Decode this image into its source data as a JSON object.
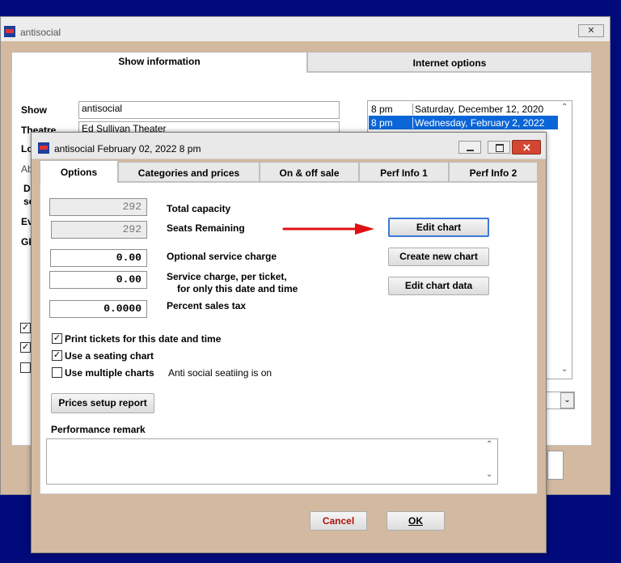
{
  "back_window": {
    "title": "antisocial",
    "close_glyph": "✕",
    "tabs": [
      "Show information",
      "Internet options"
    ],
    "labels": {
      "show": "Show",
      "theatre": "Theatre",
      "location_partial": "Lo",
      "ab_partial": "Ab",
      "di_partial": "Di",
      "se_partial": "se",
      "ev_partial": "Ev",
      "gl_partial": "GL"
    },
    "show_value": "antisocial",
    "theatre_value": "Ed Sullivan Theater",
    "performances": [
      {
        "time": "8 pm",
        "date": "Saturday, December 12, 2020",
        "selected": false
      },
      {
        "time": "8 pm",
        "date": "Wednesday, February 2, 2022",
        "selected": true
      }
    ]
  },
  "dialog": {
    "title": "antisocial February 02, 2022 8 pm",
    "tabs": [
      "Options",
      "Categories and prices",
      "On & off sale",
      "Perf Info 1",
      "Perf Info 2"
    ],
    "total_capacity": {
      "value": "292",
      "label": "Total capacity"
    },
    "seats_remaining": {
      "value": "292",
      "label": "Seats Remaining"
    },
    "optional_service_charge": {
      "value": "0.00",
      "label": "Optional service charge"
    },
    "service_charge_per_ticket": {
      "value": "0.00",
      "label_line1": "Service charge, per ticket,",
      "label_line2": "for only this date and time"
    },
    "percent_sales_tax": {
      "value": "0.0000",
      "label": "Percent sales tax"
    },
    "buttons": {
      "edit_chart": "Edit chart",
      "create_new_chart": "Create new chart",
      "edit_chart_data": "Edit chart data",
      "prices_setup_report": "Prices setup report",
      "cancel": "Cancel",
      "ok": "OK"
    },
    "checkboxes": [
      {
        "label": "Print tickets for this date and time",
        "checked": true
      },
      {
        "label": "Use a seating chart",
        "checked": true
      },
      {
        "label": "Use multiple charts",
        "checked": false
      }
    ],
    "anti_social_note": "Anti social seatiing is on",
    "performance_remark_label": "Performance remark",
    "performance_remark_value": "",
    "arrow_color": "#e01010"
  }
}
